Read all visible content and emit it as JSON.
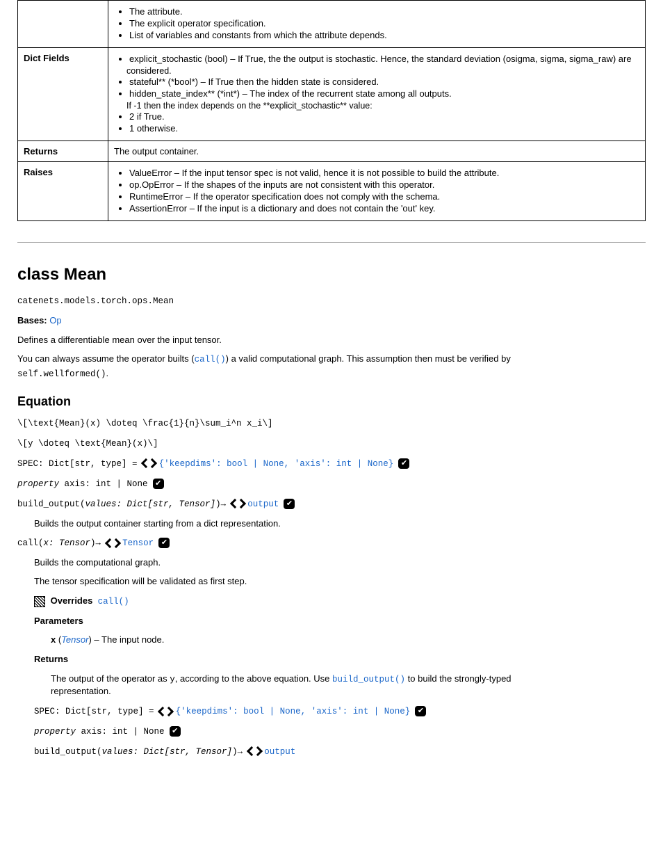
{
  "table": {
    "row0": {
      "label": "",
      "items": [
        "The attribute.",
        "The explicit operator specification.",
        "List of variables and constants from which the attribute depends."
      ]
    },
    "row1": {
      "label": "Dict Fields",
      "items": [
        {
          "t": "explicit_stochastic (bool) – If True, the the output is stochastic. Hence, the standard deviation (osigma, sigma, sigma_raw) are"
        },
        {
          "t": "considered.",
          "sub": true
        },
        {
          "t": "stateful** (*bool*) – If True then the hidden state is considered."
        },
        {
          "t": "hidden_state_index** (*int*) – The index of the recurrent state among all outputs."
        },
        {
          "t": "If -1 then the index depends on the **explicit_stochastic** value:",
          "sub": true
        },
        {
          "t": "2 if True."
        },
        {
          "t": "1 otherwise."
        }
      ]
    },
    "row2": {
      "label": "Returns",
      "text": "The output container."
    },
    "row3": {
      "label": "Raises",
      "items": [
        "ValueError – If the input tensor spec is not valid, hence it is not possible to build the attribute.",
        "op.OpError – If the shapes of the inputs are not consistent with this operator.",
        "RuntimeError – If the operator specification does not comply with the schema.",
        "AssertionError – If the input is a dictionary and does not contain the 'out' key."
      ]
    }
  },
  "section": {
    "class_title": "class Mean",
    "qual": "catenets.models.torch.ops.Mean",
    "bases_label": "Bases:",
    "bases_val": "Op",
    "classdoc_1": "Defines a differentiable mean over the input tensor.",
    "classdoc_2a": "You can always assume the operator builts (",
    "classdoc_2code": "call()",
    "classdoc_2b": ") a valid computational graph. This assumption then must be verified by",
    "classdoc_3a": "self.wellformed()",
    "classdoc_3b": ".",
    "eq_head": "Equation",
    "eq1": "\\[\\text{Mean}(x) \\doteq \\frac{1}{n}\\sum_i^n x_i\\]",
    "eq2": "\\[y \\doteq \\text{Mean}(x)\\]",
    "api1": {
      "code": "SPEC: Dict[str, type] = ",
      "link": "{'keepdims': bool | None, 'axis': int | None}",
      "check": true
    },
    "api2": {
      "code_pre": "property axis: int | None",
      "check": true
    },
    "api3": {
      "code": "build_output(values: Dict[str, Tensor])→ ",
      "link": "output",
      "check": true
    },
    "build_doc": "Builds the output container starting from a dict representation.",
    "api4": {
      "code": "call(x: Tensor)→ Tensor",
      "check": true
    },
    "call_doc1": "Builds the computational graph.",
    "call_doc2": "The tensor specification will be validated as first step.",
    "overrides_line": {
      "icon": "hatch",
      "label": "Overrides",
      "target": "call()"
    },
    "params_head": "Parameters",
    "param_x": {
      "name": "x",
      "type": "Tensor",
      "desc": "The input node."
    },
    "returns_head": "Returns",
    "returns_line1a": "The output of the operator as ",
    "returns_line1code": "y",
    "returns_line1b": ", according to the above equation. Use ",
    "returns_line1code2": "build_output()",
    "returns_line1c": " to build the strongly-typed",
    "returns_line2": "representation.",
    "api5": {
      "code": "SPEC: Dict[str, type] = ",
      "link": "{'keepdims': bool | None, 'axis': int | None}",
      "check": true
    },
    "api6": {
      "code_pre": "property axis: int | None",
      "check": true
    },
    "api7": {
      "code": "build_output(values: Dict[str, Tensor])→ ",
      "link": "output",
      "check": false
    }
  }
}
